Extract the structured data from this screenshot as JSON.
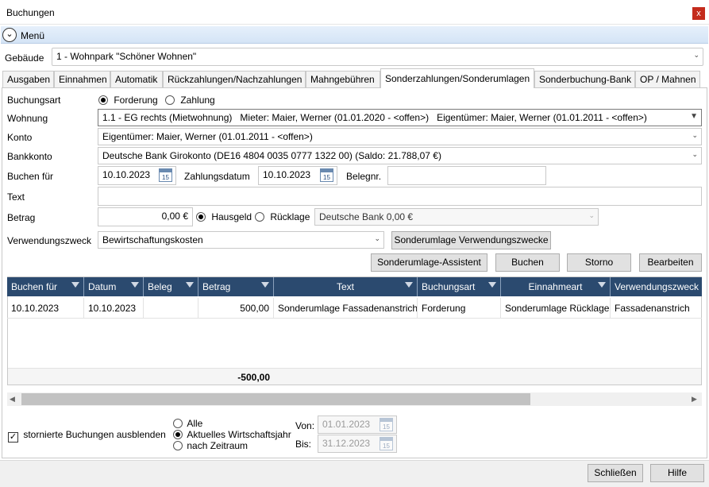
{
  "window": {
    "title": "Buchungen",
    "close": "x"
  },
  "menu": {
    "label": "Menü",
    "chevron": "⌄"
  },
  "gebaeude": {
    "label": "Gebäude",
    "value": "1 - Wohnpark \"Schöner Wohnen\""
  },
  "tabs": [
    "Ausgaben",
    "Einnahmen",
    "Automatik",
    "Rückzahlungen/Nachzahlungen",
    "Mahngebühren",
    "Sonderzahlungen/Sonderumlagen",
    "Sonderbuchung-Bank",
    "OP / Mahnen"
  ],
  "active_tab": "Sonderzahlungen/Sonderumlagen",
  "form": {
    "buchungsart_label": "Buchungsart",
    "opt_forderung": "Forderung",
    "opt_zahlung": "Zahlung",
    "wohnung_label": "Wohnung",
    "wohnung_value": "1.1 - EG rechts (Mietwohnung)   Mieter: Maier, Werner (01.01.2020 - <offen>)   Eigentümer: Maier, Werner (01.01.2011 - <offen>)",
    "konto_label": "Konto",
    "konto_value": "Eigentümer: Maier, Werner (01.01.2011 - <offen>)",
    "bankkonto_label": "Bankkonto",
    "bankkonto_value": "Deutsche Bank Girokonto (DE16 4804 0035 0777 1322 00) (Saldo: 21.788,07 €)",
    "buchen_fuer_label": "Buchen für",
    "buchen_fuer_value": "10.10.2023",
    "zahlungsdatum_label": "Zahlungsdatum",
    "zahlungsdatum_value": "10.10.2023",
    "belegnr_label": "Belegnr.",
    "belegnr_value": "",
    "text_label": "Text",
    "text_value": "",
    "betrag_label": "Betrag",
    "betrag_value": "0,00 €",
    "opt_hausgeld": "Hausgeld",
    "opt_ruecklage": "Rücklage",
    "ruecklage_konto": "Deutsche Bank 0,00 €",
    "verwendungszweck_label": "Verwendungszweck",
    "verwendungszweck_value": "Bewirtschaftungskosten",
    "cal_day": "15"
  },
  "buttons": {
    "sonderumlage_vz": "Sonderumlage Verwendungszwecke",
    "assistent": "Sonderumlage-Assistent",
    "buchen": "Buchen",
    "storno": "Storno",
    "bearbeiten": "Bearbeiten",
    "schliessen": "Schließen",
    "hilfe": "Hilfe"
  },
  "table": {
    "headers": [
      "Buchen für",
      "Datum",
      "Beleg",
      "Betrag",
      "Text",
      "Buchungsart",
      "Einnahmeart",
      "Verwendungszweck"
    ],
    "rows": [
      [
        "10.10.2023",
        "10.10.2023",
        "",
        "500,00",
        "Sonderumlage Fassadenanstrich",
        "Forderung",
        "Sonderumlage Rücklage",
        "Fassadenanstrich"
      ]
    ],
    "sum": "-500,00"
  },
  "footer": {
    "storniert_label": "stornierte Buchungen ausblenden",
    "opt_alle": "Alle",
    "opt_aktuell": "Aktuelles Wirtschaftsjahr",
    "opt_zeitraum": "nach Zeitraum",
    "von_label": "Von:",
    "von_value": "01.01.2023",
    "bis_label": "Bis:",
    "bis_value": "31.12.2023"
  }
}
